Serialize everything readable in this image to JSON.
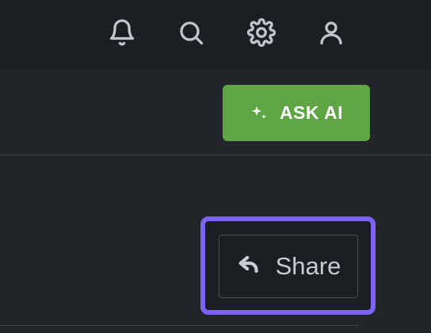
{
  "topbar": {
    "icons": [
      {
        "name": "bell-icon"
      },
      {
        "name": "search-icon"
      },
      {
        "name": "gear-icon"
      },
      {
        "name": "user-icon"
      }
    ]
  },
  "toolbar": {
    "ask_ai_label": "ASK AI",
    "ask_ai_icon": "sparkle-icon"
  },
  "content": {
    "share_label": "Share",
    "share_icon": "share-back-arrow-icon"
  },
  "colors": {
    "background": "#22262b",
    "topbar": "#1b1f24",
    "ask_ai": "#5fa544",
    "focus_ring": "#7a63f5",
    "text_light": "#c6ccd3"
  }
}
